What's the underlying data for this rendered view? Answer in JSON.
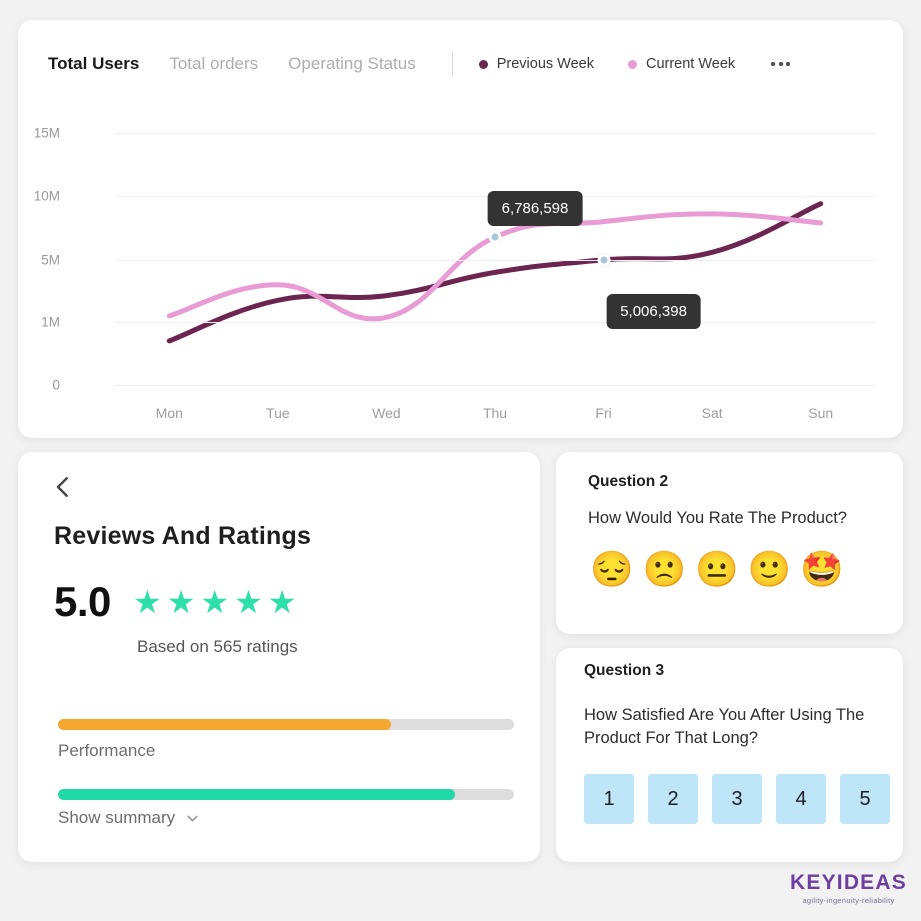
{
  "chart_card": {
    "tabs": [
      {
        "label": "Total Users",
        "active": true
      },
      {
        "label": "Total orders",
        "active": false
      },
      {
        "label": "Operating Status",
        "active": false
      }
    ],
    "legend": [
      {
        "label": "Previous Week",
        "color": "#6b2550"
      },
      {
        "label": "Current Week",
        "color": "#e89bd4"
      }
    ],
    "menu_icon": "more-horizontal-icon"
  },
  "chart_data": {
    "type": "line",
    "title": "Total Users",
    "xlabel": "",
    "ylabel": "",
    "grid": true,
    "legend_position": "top-right",
    "categories": [
      "Mon",
      "Tue",
      "Wed",
      "Thu",
      "Fri",
      "Sat",
      "Sun"
    ],
    "ytick_labels": [
      "15M",
      "10M",
      "5M",
      "1M",
      "0"
    ],
    "ytick_values": [
      15000000,
      10000000,
      5000000,
      1000000,
      0
    ],
    "ylim": [
      0,
      15000000
    ],
    "series": [
      {
        "name": "Previous Week",
        "color": "#6b2550",
        "values": [
          700000,
          2400000,
          2700000,
          4200000,
          5006398,
          5600000,
          9400000
        ]
      },
      {
        "name": "Current Week",
        "color": "#e89bd4",
        "values": [
          1400000,
          3400000,
          1300000,
          6786598,
          8000000,
          8600000,
          7900000
        ]
      }
    ],
    "annotations": [
      {
        "label": "6,786,598",
        "series": "Current Week",
        "category": "Thu",
        "value": 6786598
      },
      {
        "label": "5,006,398",
        "series": "Previous Week",
        "category": "Fri",
        "value": 5006398
      }
    ]
  },
  "reviews_card": {
    "back_icon": "back-chevron-icon",
    "title": "Reviews And Ratings",
    "score": "5.0",
    "stars_filled": 5,
    "star_glyph": "★",
    "star_color": "#2ee0a8",
    "ratings_text": "Based on 565 ratings",
    "bars": [
      {
        "label": "Performance",
        "percent": 73,
        "color": "#f5a62e"
      },
      {
        "label": "Show summary",
        "percent": 87,
        "color": "#22d8a6",
        "has_chevron": true
      }
    ]
  },
  "question2": {
    "title": "Question 2",
    "text": "How Would You Rate The Product?",
    "emojis": [
      {
        "name": "pensive-face-emoji",
        "glyph": "😔"
      },
      {
        "name": "frowning-face-emoji",
        "glyph": "🙁"
      },
      {
        "name": "neutral-face-emoji",
        "glyph": "😐"
      },
      {
        "name": "slightly-smiling-face-emoji",
        "glyph": "🙂"
      },
      {
        "name": "star-struck-emoji",
        "glyph": "🤩"
      }
    ]
  },
  "question3": {
    "title": "Question 3",
    "text": "How Satisfied Are You After Using The Product For That Long?",
    "options": [
      "1",
      "2",
      "3",
      "4",
      "5"
    ]
  },
  "logo": {
    "name": "KEYIDEAS",
    "tagline": "agility-ingenuity-reliability",
    "color": "#6e3f9e"
  }
}
